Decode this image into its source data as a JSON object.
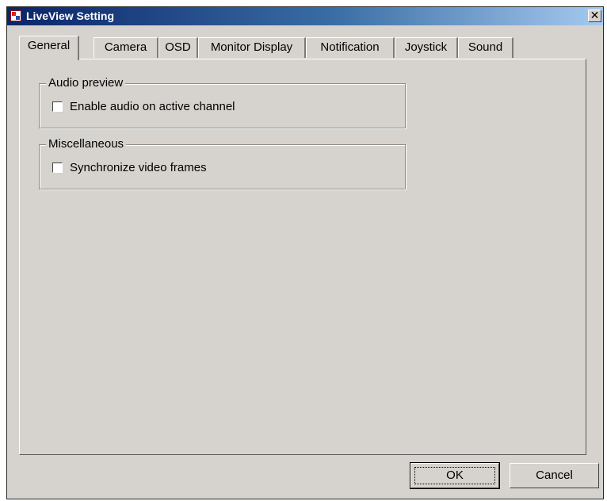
{
  "window": {
    "title": "LiveView Setting",
    "close_glyph": "✕"
  },
  "tabs": [
    {
      "label": "General",
      "active": true
    },
    {
      "label": "Camera"
    },
    {
      "label": "OSD"
    },
    {
      "label": "Monitor Display"
    },
    {
      "label": "Notification"
    },
    {
      "label": "Joystick"
    },
    {
      "label": "Sound"
    }
  ],
  "groups": {
    "audio": {
      "title": "Audio preview",
      "option": {
        "label": "Enable audio on active channel",
        "checked": false
      }
    },
    "misc": {
      "title": "Miscellaneous",
      "option": {
        "label": "Synchronize video frames",
        "checked": false
      }
    }
  },
  "buttons": {
    "ok": "OK",
    "cancel": "Cancel"
  },
  "icons": {
    "app": "app-icon",
    "close": "close-icon"
  },
  "colors": {
    "dialog_bg": "#d6d3ce",
    "title_bar_start": "#0a246a",
    "title_bar_end": "#a6caf0"
  }
}
